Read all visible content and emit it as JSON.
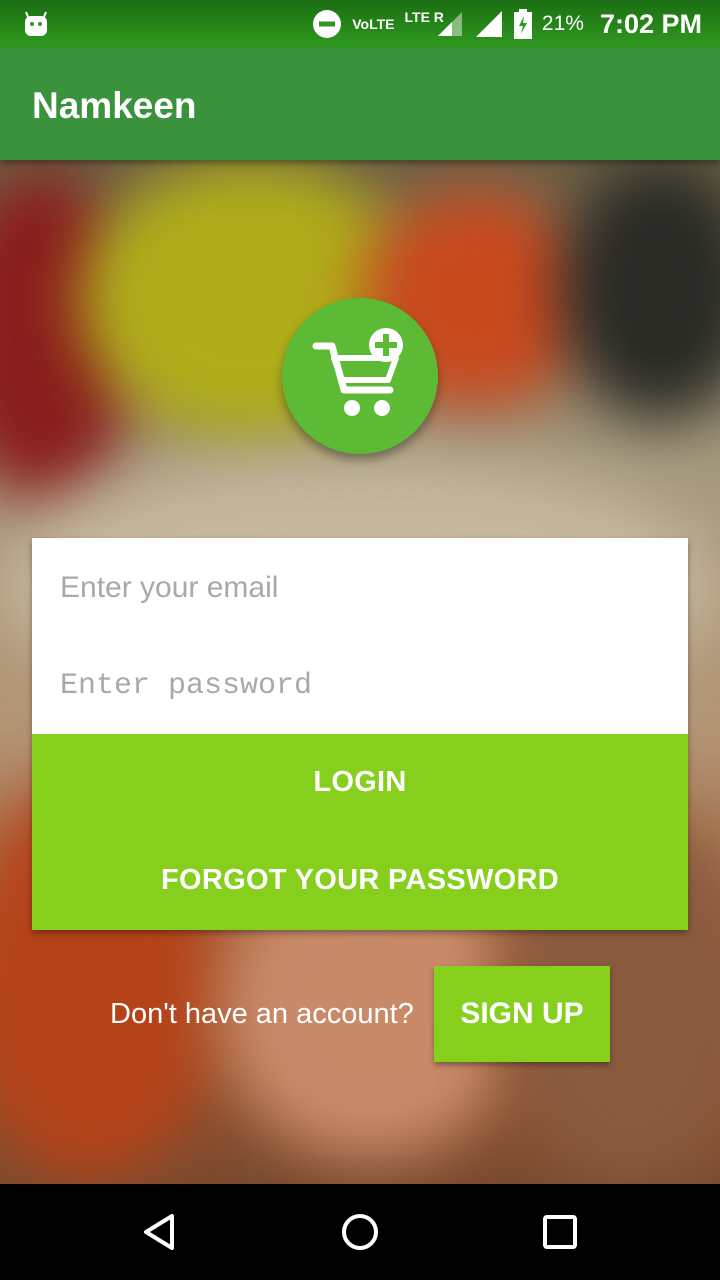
{
  "status_bar": {
    "network_label": "VoLTE",
    "lte_label": "LTE R",
    "battery_percent": "21%",
    "time": "7:02 PM"
  },
  "app_bar": {
    "title": "Namkeen"
  },
  "login_form": {
    "email_placeholder": "Enter your email",
    "password_placeholder": "Enter password",
    "login_label": "LOGIN",
    "forgot_label": "FORGOT YOUR PASSWORD"
  },
  "signup": {
    "prompt": "Don't have an account?",
    "button_label": "SIGN UP"
  },
  "icons": {
    "logo": "cart-plus-icon",
    "nav_back": "back-triangle-icon",
    "nav_home": "home-circle-icon",
    "nav_recents": "recents-square-icon"
  },
  "colors": {
    "app_bar": "#3a923d",
    "accent": "#86cf1c",
    "logo": "#5cba35"
  }
}
